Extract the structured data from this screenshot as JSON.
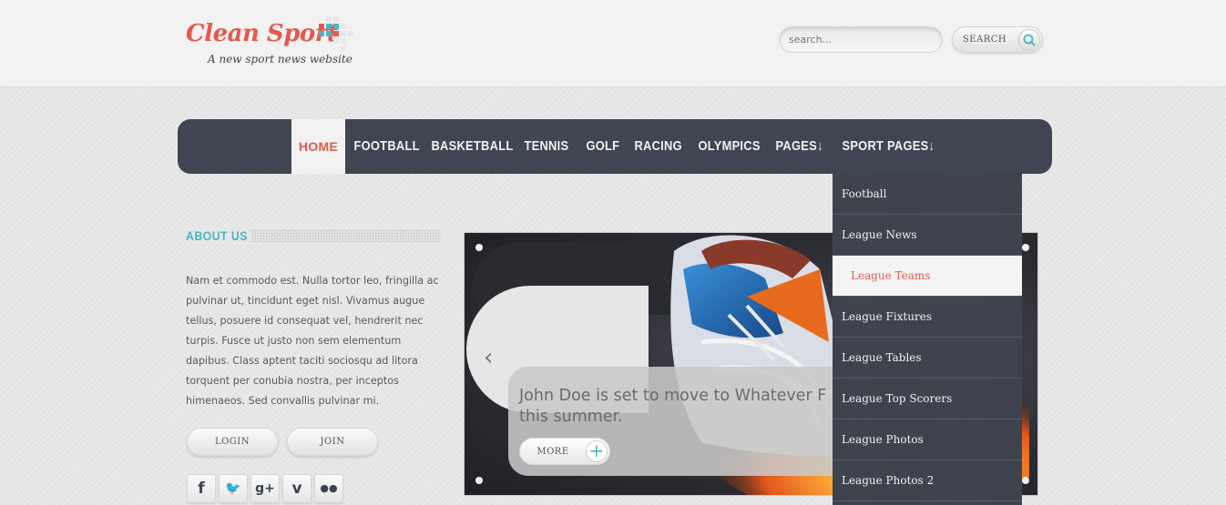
{
  "site": {
    "name": "Clean Sport",
    "tagline": "A new sport news website",
    "brand_color": "#e25a4e",
    "accent_color": "#4bb3c4"
  },
  "search": {
    "placeholder": "search...",
    "button_label": "SEARCH",
    "icon": "search-icon"
  },
  "nav": {
    "items": [
      {
        "label": "HOME",
        "active": true
      },
      {
        "label": "FOOTBALL"
      },
      {
        "label": "BASKETBALL"
      },
      {
        "label": "TENNIS"
      },
      {
        "label": "GOLF"
      },
      {
        "label": "RACING"
      },
      {
        "label": "OLYMPICS"
      },
      {
        "label": "PAGES↓"
      },
      {
        "label": "SPORT PAGES↓"
      }
    ],
    "dropdown": [
      {
        "label": "Football"
      },
      {
        "label": "League News"
      },
      {
        "label": "League Teams",
        "active": true
      },
      {
        "label": "League Fixtures"
      },
      {
        "label": "League Tables"
      },
      {
        "label": "League Top Scorers"
      },
      {
        "label": "League Photos"
      },
      {
        "label": "League Photos 2"
      }
    ]
  },
  "about": {
    "title": "ABOUT US",
    "text": "Nam et commodo est. Nulla tortor leo, fringilla ac pulvinar ut, tincidunt eget nisl. Vivamus augue tellus, posuere id consequat vel, hendrerit nec turpis. Fusce ut justo non sem elementum dapibus. Class aptent taciti sociosqu ad litora torquent per conubia nostra, per inceptos himenaeos. Sed convallis pulvinar mi.",
    "login_label": "LOGIN",
    "join_label": "JOIN"
  },
  "social": [
    {
      "glyph": "f",
      "icon": "facebook-icon"
    },
    {
      "glyph": "🐦",
      "icon": "twitter-icon"
    },
    {
      "glyph": "g+",
      "icon": "google-plus-icon"
    },
    {
      "glyph": "v",
      "icon": "vimeo-icon"
    },
    {
      "glyph": "●●",
      "icon": "flickr-icon"
    }
  ],
  "slider": {
    "caption": "John Doe is set to move to Whatever F club this summer.",
    "more_label": "MORE",
    "prev_glyph": "‹",
    "plus_glyph": "+"
  }
}
